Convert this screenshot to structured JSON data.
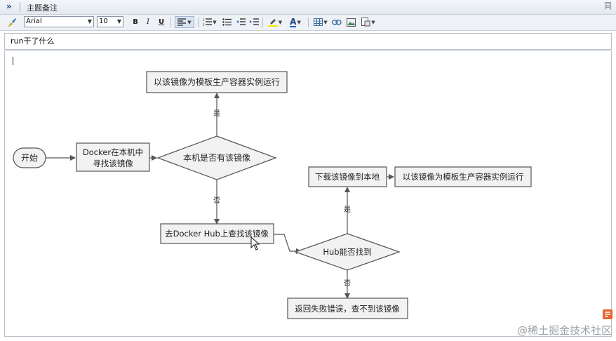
{
  "window": {
    "title": "主题备注",
    "expand_glyph": "»",
    "corner_glyph": "同"
  },
  "toolbar": {
    "font_name": "Arial",
    "font_size": "10",
    "bold": "B",
    "italic": "I",
    "underline": "U",
    "text_color_glyph": "A"
  },
  "subject": {
    "value": "run干了什么"
  },
  "flowchart": {
    "start": "开始",
    "search_local": "Docker在本机中寻找该镜像",
    "has_image": "本机是否有该镜像",
    "run_top": "以该镜像为模板生产容器实例运行",
    "yes_top": "是",
    "no_left": "否",
    "search_hub": "去Docker Hub上查找该镜像",
    "hub_found": "Hub能否找到",
    "yes_right": "是",
    "no_bottom": "否",
    "download": "下载该镜像到本地",
    "run_right": "以该镜像为模板生产容器实例运行",
    "error": "返回失败错误，查不到该镜像"
  },
  "watermark": "@稀土掘金技术社区",
  "colors": {
    "node_fill": "#f2f2f2",
    "node_stroke": "#555555",
    "edge": "#555555",
    "logo_orange": "#e8622c"
  },
  "icons": [
    "brush-icon",
    "bold-icon",
    "italic-icon",
    "underline-icon",
    "align-left-icon",
    "numbered-list-icon",
    "bullet-list-icon",
    "outdent-icon",
    "indent-icon",
    "highlight-icon",
    "font-color-icon",
    "table-icon",
    "link-icon",
    "image-icon",
    "insert-object-icon",
    "cursor-icon",
    "logo-icon"
  ]
}
